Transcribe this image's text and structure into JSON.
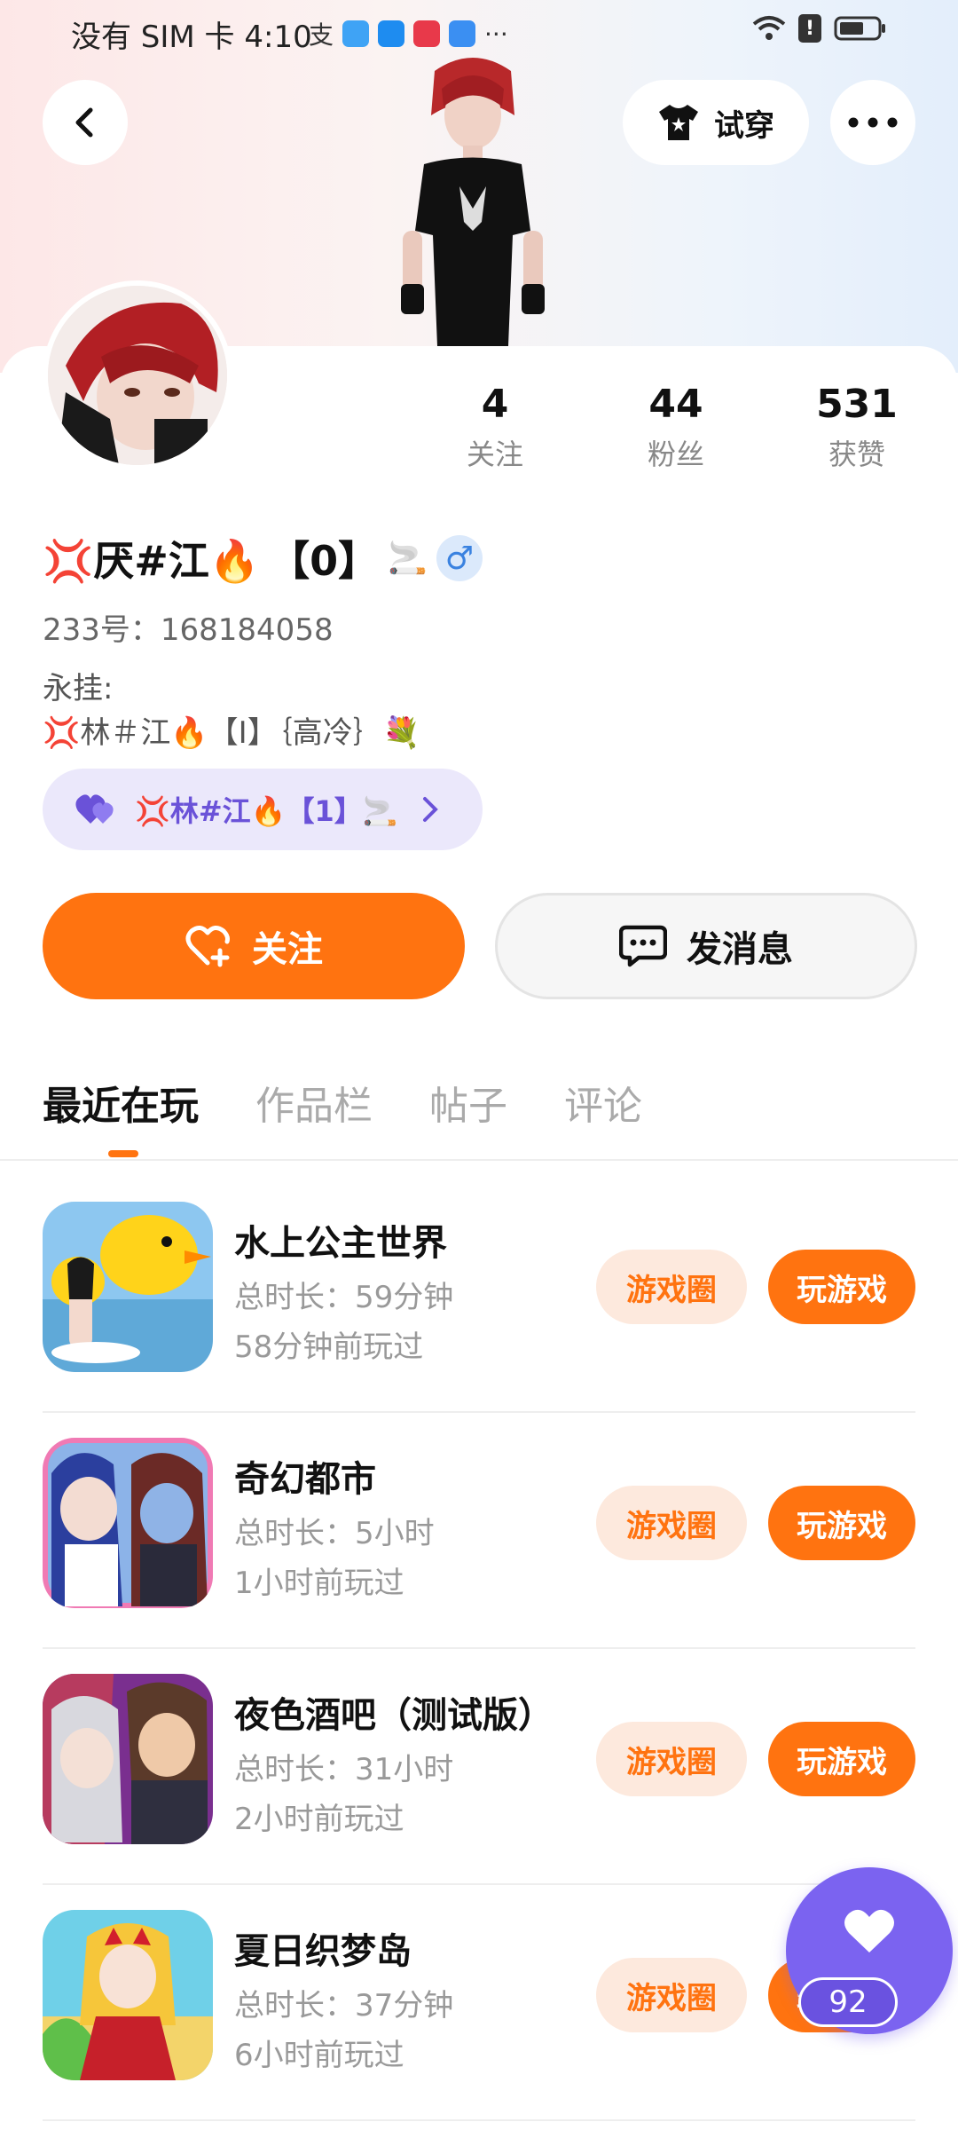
{
  "status_bar": {
    "carrier": "没有 SIM 卡",
    "time": "4:10",
    "more": "···"
  },
  "header": {
    "try_on_label": "试穿"
  },
  "profile": {
    "stats": [
      {
        "value": "4",
        "label": "关注"
      },
      {
        "value": "44",
        "label": "粉丝"
      },
      {
        "value": "531",
        "label": "获赞"
      }
    ],
    "name_pre": "💢厌#江🔥",
    "name_tag": "【0】",
    "name_post": "🚬",
    "gender_symbol": "♂",
    "uid": "233号：168184058",
    "bio_line1": "永挂:",
    "bio_line2": "💢林＃江🔥【Ⅰ】｛高冷｝💐",
    "cp_label": "💢林#江🔥【1】🚬"
  },
  "actions": {
    "follow_label": "关注",
    "message_label": "发消息"
  },
  "tabs": [
    {
      "label": "最近在玩",
      "active": true
    },
    {
      "label": "作品栏",
      "active": false
    },
    {
      "label": "帖子",
      "active": false
    },
    {
      "label": "评论",
      "active": false
    }
  ],
  "games": [
    {
      "title": "水上公主世界",
      "duration": "总时长：59分钟",
      "last_played": "58分钟前玩过",
      "circle_label": "游戏圈",
      "play_label": "玩游戏"
    },
    {
      "title": "奇幻都市",
      "duration": "总时长：5小时",
      "last_played": "1小时前玩过",
      "circle_label": "游戏圈",
      "play_label": "玩游戏"
    },
    {
      "title": "夜色酒吧（测试版）",
      "duration": "总时长：31小时",
      "last_played": "2小时前玩过",
      "circle_label": "游戏圈",
      "play_label": "玩游戏"
    },
    {
      "title": "夏日织梦岛",
      "duration": "总时长：37分钟",
      "last_played": "6小时前玩过",
      "circle_label": "游戏圈",
      "play_label": "玩游戏"
    }
  ],
  "fab": {
    "count": "92"
  },
  "colors": {
    "accent": "#ff7310",
    "purple": "#7b63f0"
  }
}
